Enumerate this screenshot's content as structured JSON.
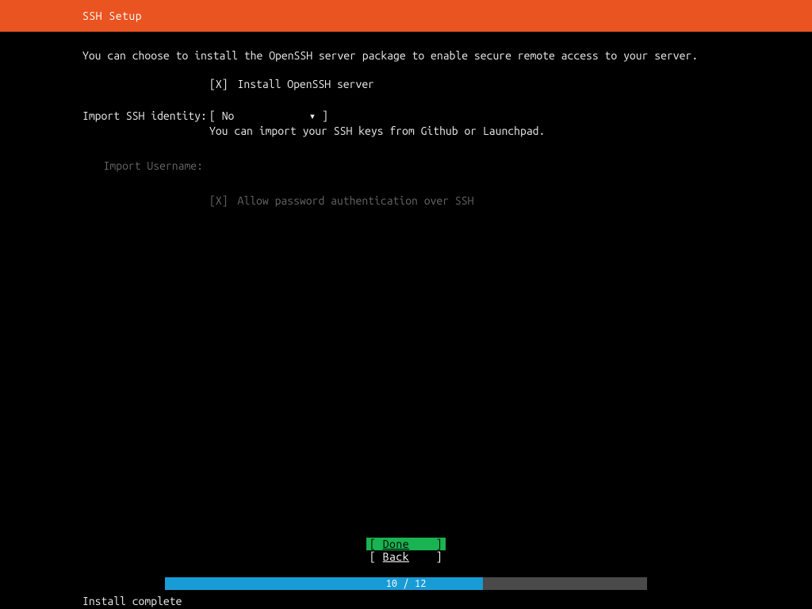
{
  "header": {
    "title": "SSH Setup"
  },
  "intro": "You can choose to install the OpenSSH server package to enable secure remote access to your server.",
  "install": {
    "label": "",
    "checkbox": "[X]",
    "text": "Install OpenSSH server"
  },
  "import_identity": {
    "label": "Import SSH identity:",
    "open": "[ ",
    "value": "No",
    "caret": "▾",
    "close": " ]",
    "hint": "You can import your SSH keys from Github or Launchpad."
  },
  "import_username": {
    "label": "Import Username:"
  },
  "allow_password": {
    "checkbox": "[X]",
    "text": "Allow password authentication over SSH"
  },
  "buttons": {
    "done_open": "[ ",
    "done": "Done",
    "done_close": " ]",
    "back_open": "[ ",
    "back": "Back",
    "back_close": " ]"
  },
  "progress": {
    "text": "10 / 12"
  },
  "status": "Install complete"
}
